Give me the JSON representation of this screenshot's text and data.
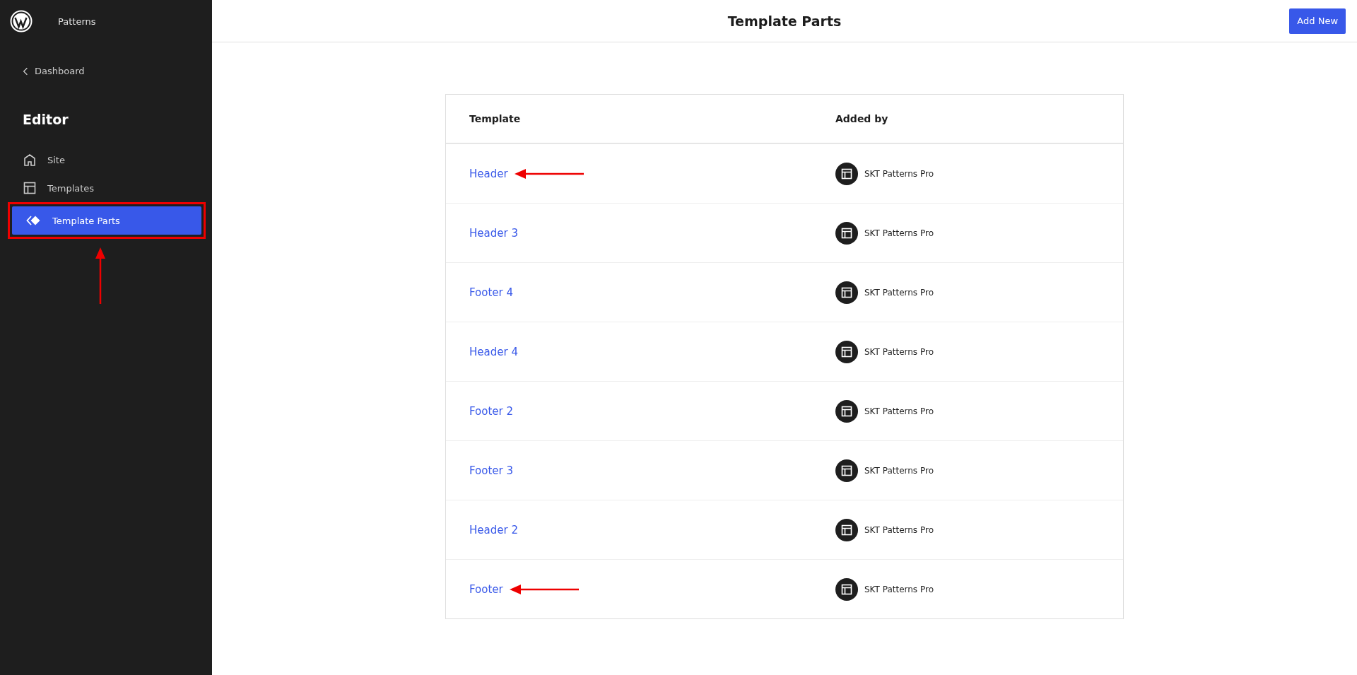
{
  "sidebar": {
    "site_title": "Patterns",
    "back_link": "Dashboard",
    "heading": "Editor",
    "items": [
      {
        "label": "Site",
        "selected": false,
        "highlighted": false
      },
      {
        "label": "Templates",
        "selected": false,
        "highlighted": false
      },
      {
        "label": "Template Parts",
        "selected": true,
        "highlighted": true
      }
    ]
  },
  "header": {
    "title": "Template Parts",
    "button": "Add New"
  },
  "table": {
    "columns": [
      "Template",
      "Added by"
    ],
    "rows": [
      {
        "template": "Header",
        "added_by": "SKT Patterns Pro",
        "arrow": true
      },
      {
        "template": "Header 3",
        "added_by": "SKT Patterns Pro",
        "arrow": false
      },
      {
        "template": "Footer 4",
        "added_by": "SKT Patterns Pro",
        "arrow": false
      },
      {
        "template": "Header 4",
        "added_by": "SKT Patterns Pro",
        "arrow": false
      },
      {
        "template": "Footer 2",
        "added_by": "SKT Patterns Pro",
        "arrow": false
      },
      {
        "template": "Footer 3",
        "added_by": "SKT Patterns Pro",
        "arrow": false
      },
      {
        "template": "Header 2",
        "added_by": "SKT Patterns Pro",
        "arrow": false
      },
      {
        "template": "Footer",
        "added_by": "SKT Patterns Pro",
        "arrow": true
      }
    ]
  }
}
